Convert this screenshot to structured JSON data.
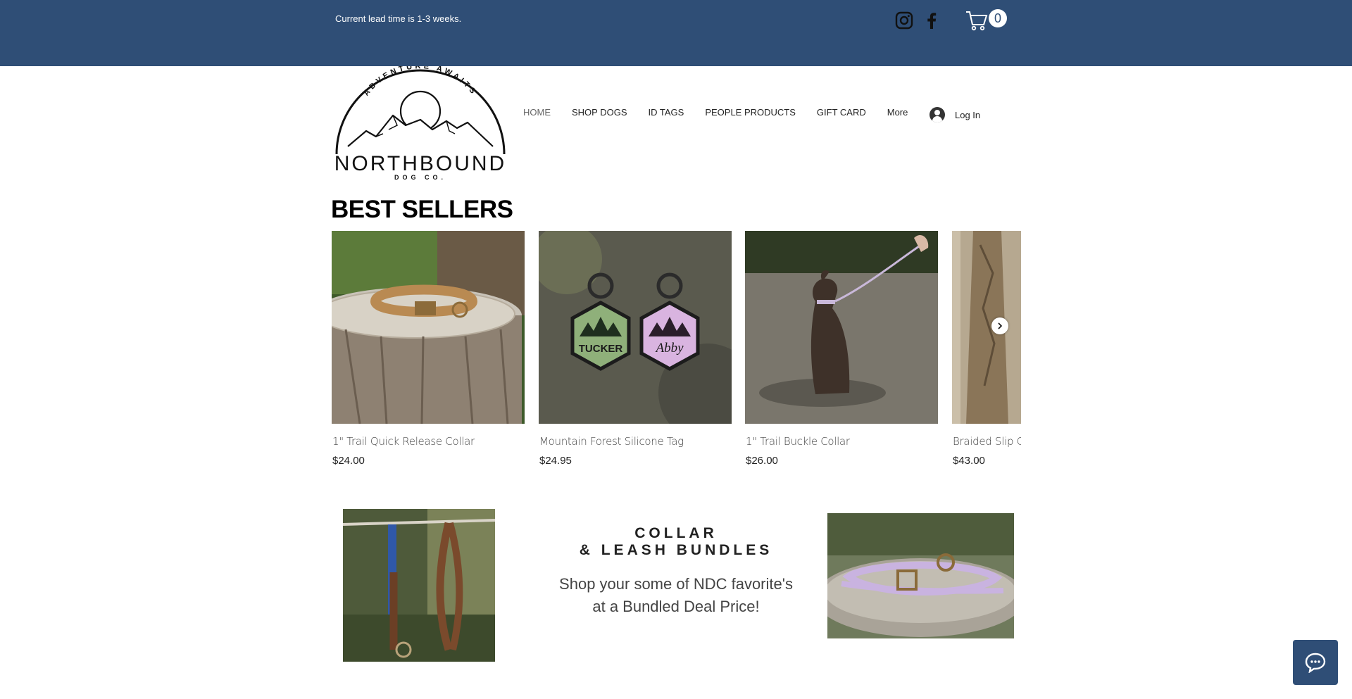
{
  "header": {
    "lead_time": "Current lead time is 1-3 weeks.",
    "cart_count": "0",
    "background_color": "#2f4e76",
    "icons": [
      "instagram-icon",
      "facebook-icon",
      "cart-icon"
    ]
  },
  "logo": {
    "arc_text": "ADVENTURE AWAITS",
    "brand": "NORTHBOUND",
    "sub": "DOG CO."
  },
  "nav": {
    "items": [
      "HOME",
      "SHOP DOGS",
      "ID TAGS",
      "PEOPLE PRODUCTS",
      "GIFT CARD",
      "More"
    ],
    "active": "HOME",
    "login_label": "Log In"
  },
  "best_sellers": {
    "title": "BEST SELLERS",
    "products": [
      {
        "name": "1\" Trail Quick Release Collar",
        "price": "$24.00"
      },
      {
        "name": "Mountain Forest Silicone Tag",
        "price": "$24.95",
        "tag_names": [
          "TUCKER",
          "Abby"
        ]
      },
      {
        "name": "1\" Trail Buckle Collar",
        "price": "$26.00"
      },
      {
        "name": "Braided Slip Co",
        "price": "$43.00"
      }
    ]
  },
  "bundles": {
    "heading_line1": "COLLAR",
    "heading_line2": "& LEASH BUNDLES",
    "text_line1": "Shop your some of NDC favorite's",
    "text_line2": "at a Bundled Deal Price!"
  }
}
